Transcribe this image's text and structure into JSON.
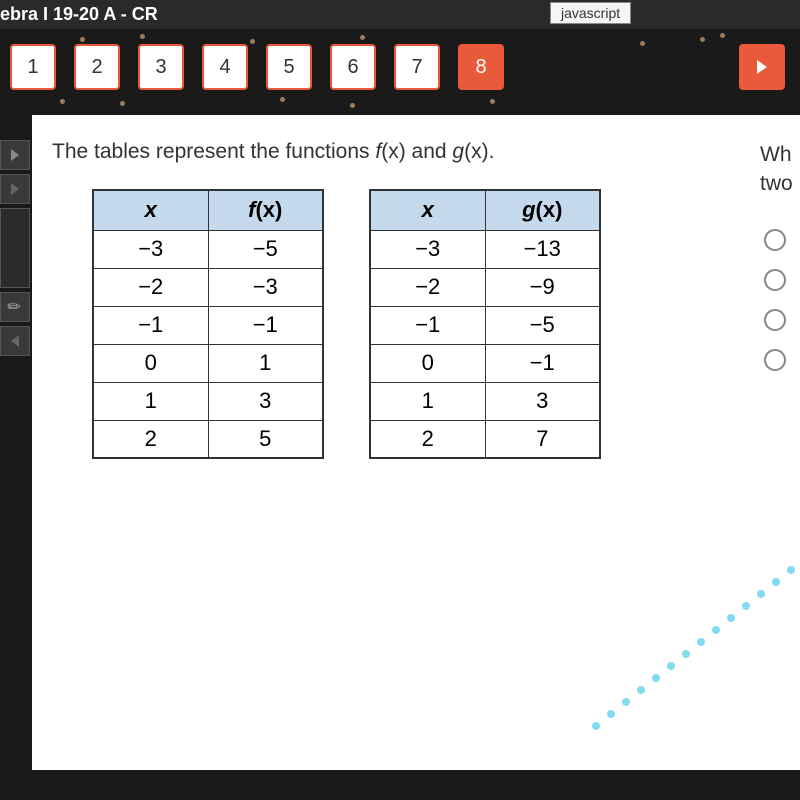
{
  "header": {
    "title": "ebra I 19-20 A - CR",
    "badge": "javascript"
  },
  "nav": {
    "buttons": [
      "1",
      "2",
      "3",
      "4",
      "5",
      "6",
      "7",
      "8"
    ],
    "active": "8"
  },
  "question": {
    "prefix": "The tables represent the functions ",
    "f": "f",
    "g": "g",
    "x1": "(x)",
    "and": " and ",
    "x2": "(x).",
    "right_partial_1": "Wh",
    "right_partial_2": "two"
  },
  "table1": {
    "headers": {
      "col1": "x",
      "col2_fn": "f",
      "col2_x": "(x)"
    },
    "rows": [
      {
        "x": "−3",
        "y": "−5"
      },
      {
        "x": "−2",
        "y": "−3"
      },
      {
        "x": "−1",
        "y": "−1"
      },
      {
        "x": "0",
        "y": "1"
      },
      {
        "x": "1",
        "y": "3"
      },
      {
        "x": "2",
        "y": "5"
      }
    ]
  },
  "table2": {
    "headers": {
      "col1": "x",
      "col2_fn": "g",
      "col2_x": "(x)"
    },
    "rows": [
      {
        "x": "−3",
        "y": "−13"
      },
      {
        "x": "−2",
        "y": "−9"
      },
      {
        "x": "−1",
        "y": "−5"
      },
      {
        "x": "0",
        "y": "−1"
      },
      {
        "x": "1",
        "y": "3"
      },
      {
        "x": "2",
        "y": "7"
      }
    ]
  }
}
